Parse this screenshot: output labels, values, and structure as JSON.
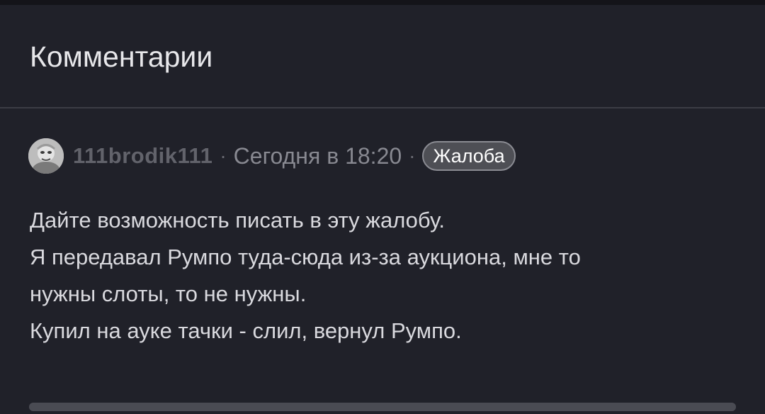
{
  "section": {
    "title": "Комментарии"
  },
  "comment": {
    "username": "111brodik111",
    "separator": "·",
    "timestamp": "Сегодня в 18:20",
    "report_label": "Жалоба",
    "avatar_icon": "user-avatar-icon",
    "lines": [
      "Дайте возможность писать в эту жалобу.",
      "Я передавал Румпо туда-сюда из-за аукциона, мне то",
      "нужны слоты, то не нужны.",
      "Купил на ауке тачки - слил, вернул Румпо."
    ]
  },
  "colors": {
    "background": "#202129",
    "title_text": "#e7e7ea",
    "username_text": "#62636b",
    "meta_text": "#888991",
    "body_text": "#d9d9de",
    "report_bg": "#4e4f55",
    "divider": "#3b3c44"
  }
}
